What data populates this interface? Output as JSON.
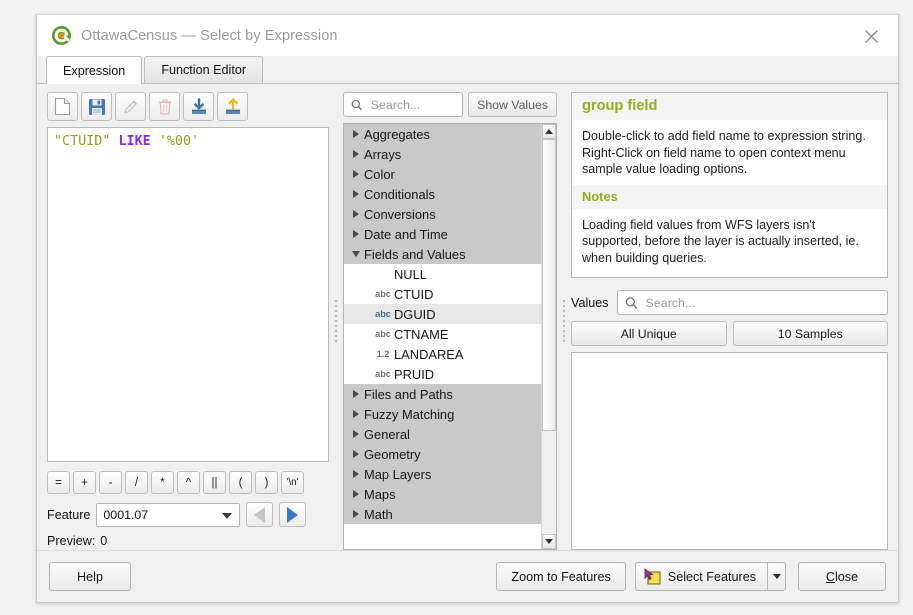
{
  "window": {
    "title": "OttawaCensus — Select by Expression",
    "logo_icon": "qgis-logo-icon",
    "close_icon": "close-icon"
  },
  "tabs": [
    {
      "label": "Expression",
      "active": true
    },
    {
      "label": "Function Editor",
      "active": false
    }
  ],
  "expression_toolbar": [
    {
      "name": "new-expression-button",
      "icon": "new-file-icon",
      "enabled": true
    },
    {
      "name": "save-expression-button",
      "icon": "save-floppy-icon",
      "enabled": true
    },
    {
      "name": "edit-expression-button",
      "icon": "pencil-edit-icon",
      "enabled": false
    },
    {
      "name": "delete-expression-button",
      "icon": "trash-delete-icon",
      "enabled": false
    },
    {
      "name": "import-expressions-button",
      "icon": "import-down-arrow-icon",
      "enabled": true
    },
    {
      "name": "export-expressions-button",
      "icon": "export-up-arrow-icon",
      "enabled": true
    }
  ],
  "expression": {
    "field_token": "\"CTUID\"",
    "operator_token": "LIKE",
    "string_token": "'%00'"
  },
  "operators": [
    "=",
    "+",
    "-",
    "/",
    "*",
    "^",
    "||",
    "(",
    ")",
    "'\\n'"
  ],
  "feature": {
    "label": "Feature",
    "value": "0001.07",
    "prev_icon": "previous-feature-icon",
    "next_icon": "next-feature-icon",
    "prev_enabled": false,
    "next_enabled": true
  },
  "preview": {
    "label": "Preview:",
    "value": "0"
  },
  "function_search": {
    "placeholder": "Search...",
    "icon": "search-icon"
  },
  "show_values_button": "Show Values",
  "tree": [
    {
      "label": "Aggregates",
      "type": "group",
      "expanded": false
    },
    {
      "label": "Arrays",
      "type": "group",
      "expanded": false
    },
    {
      "label": "Color",
      "type": "group",
      "expanded": false
    },
    {
      "label": "Conditionals",
      "type": "group",
      "expanded": false
    },
    {
      "label": "Conversions",
      "type": "group",
      "expanded": false
    },
    {
      "label": "Date and Time",
      "type": "group",
      "expanded": false
    },
    {
      "label": "Fields and Values",
      "type": "group",
      "expanded": true
    },
    {
      "label": "NULL",
      "type": "field",
      "icon": "",
      "selected": false
    },
    {
      "label": "CTUID",
      "type": "field",
      "icon": "abc",
      "selected": false
    },
    {
      "label": "DGUID",
      "type": "field",
      "icon": "abc",
      "selected": true
    },
    {
      "label": "CTNAME",
      "type": "field",
      "icon": "abc",
      "selected": false
    },
    {
      "label": "LANDAREA",
      "type": "field",
      "icon": "1.2",
      "selected": false
    },
    {
      "label": "PRUID",
      "type": "field",
      "icon": "abc",
      "selected": false
    },
    {
      "label": "Files and Paths",
      "type": "group",
      "expanded": false
    },
    {
      "label": "Fuzzy Matching",
      "type": "group",
      "expanded": false
    },
    {
      "label": "General",
      "type": "group",
      "expanded": false
    },
    {
      "label": "Geometry",
      "type": "group",
      "expanded": false
    },
    {
      "label": "Map Layers",
      "type": "group",
      "expanded": false
    },
    {
      "label": "Maps",
      "type": "group",
      "expanded": false
    },
    {
      "label": "Math",
      "type": "group",
      "expanded": false
    }
  ],
  "help": {
    "title": "group field",
    "body": "Double-click to add field name to expression string. Right-Click on field name to open context menu sample value loading options.",
    "notes_title": "Notes",
    "notes_body": "Loading field values from WFS layers isn't supported, before the layer is actually inserted, ie. when building queries."
  },
  "values": {
    "label": "Values",
    "search_placeholder": "Search...",
    "search_icon": "search-icon",
    "all_unique_button": "All Unique",
    "samples_button": "10 Samples"
  },
  "footer": {
    "help_button": "Help",
    "zoom_button": "Zoom to Features",
    "select_button": "Select Features",
    "select_icon": "select-features-icon",
    "dropdown_icon": "chevron-down-icon",
    "close_button": "Close",
    "close_accel": "C",
    "close_rest": "lose"
  },
  "colors": {
    "accent_green": "#96ac1e",
    "operator_purple": "#8a2be2",
    "token_olive": "#9a9a18",
    "arrow_blue": "#3b78c3",
    "group_bg": "#c9c9c9"
  }
}
